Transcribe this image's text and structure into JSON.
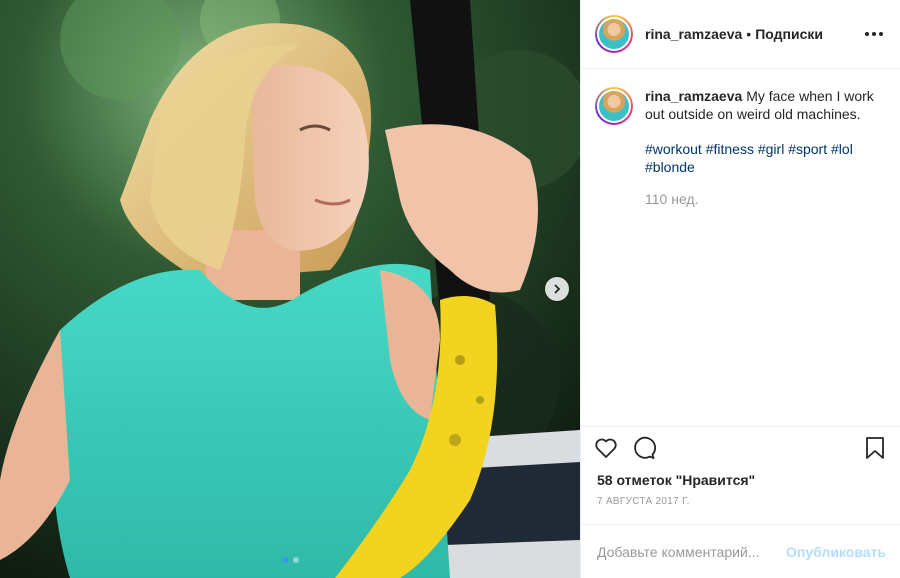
{
  "media": {
    "next_icon": "chevron-right-icon",
    "carousel_count": 2,
    "carousel_active": 1
  },
  "header": {
    "username": "rina_ramzaeva",
    "separator": "•",
    "follow_label": "Подписки",
    "more_icon": "more-options-icon"
  },
  "caption": {
    "username": "rina_ramzaeva",
    "text": "My face when I work out outside on weird old machines.",
    "hashtags": [
      "#workout",
      "#fitness",
      "#girl",
      "#sport",
      "#lol",
      "#blonde"
    ],
    "time_ago": "110 нед."
  },
  "actions": {
    "like_icon": "heart-icon",
    "comment_icon": "comment-icon",
    "save_icon": "bookmark-icon"
  },
  "likes": "58 отметок \"Нравится\"",
  "date": "7 АВГУСТА 2017 Г.",
  "comment_box": {
    "placeholder": "Добавьте комментарий...",
    "publish_label": "Опубликовать"
  },
  "colors": {
    "hashtag": "#003569",
    "publish_disabled": "#b2dffc",
    "secondary_text": "#999999",
    "active_dot": "#3897f0",
    "shirt": "#3fd1c0",
    "handle": "#f2d320"
  }
}
